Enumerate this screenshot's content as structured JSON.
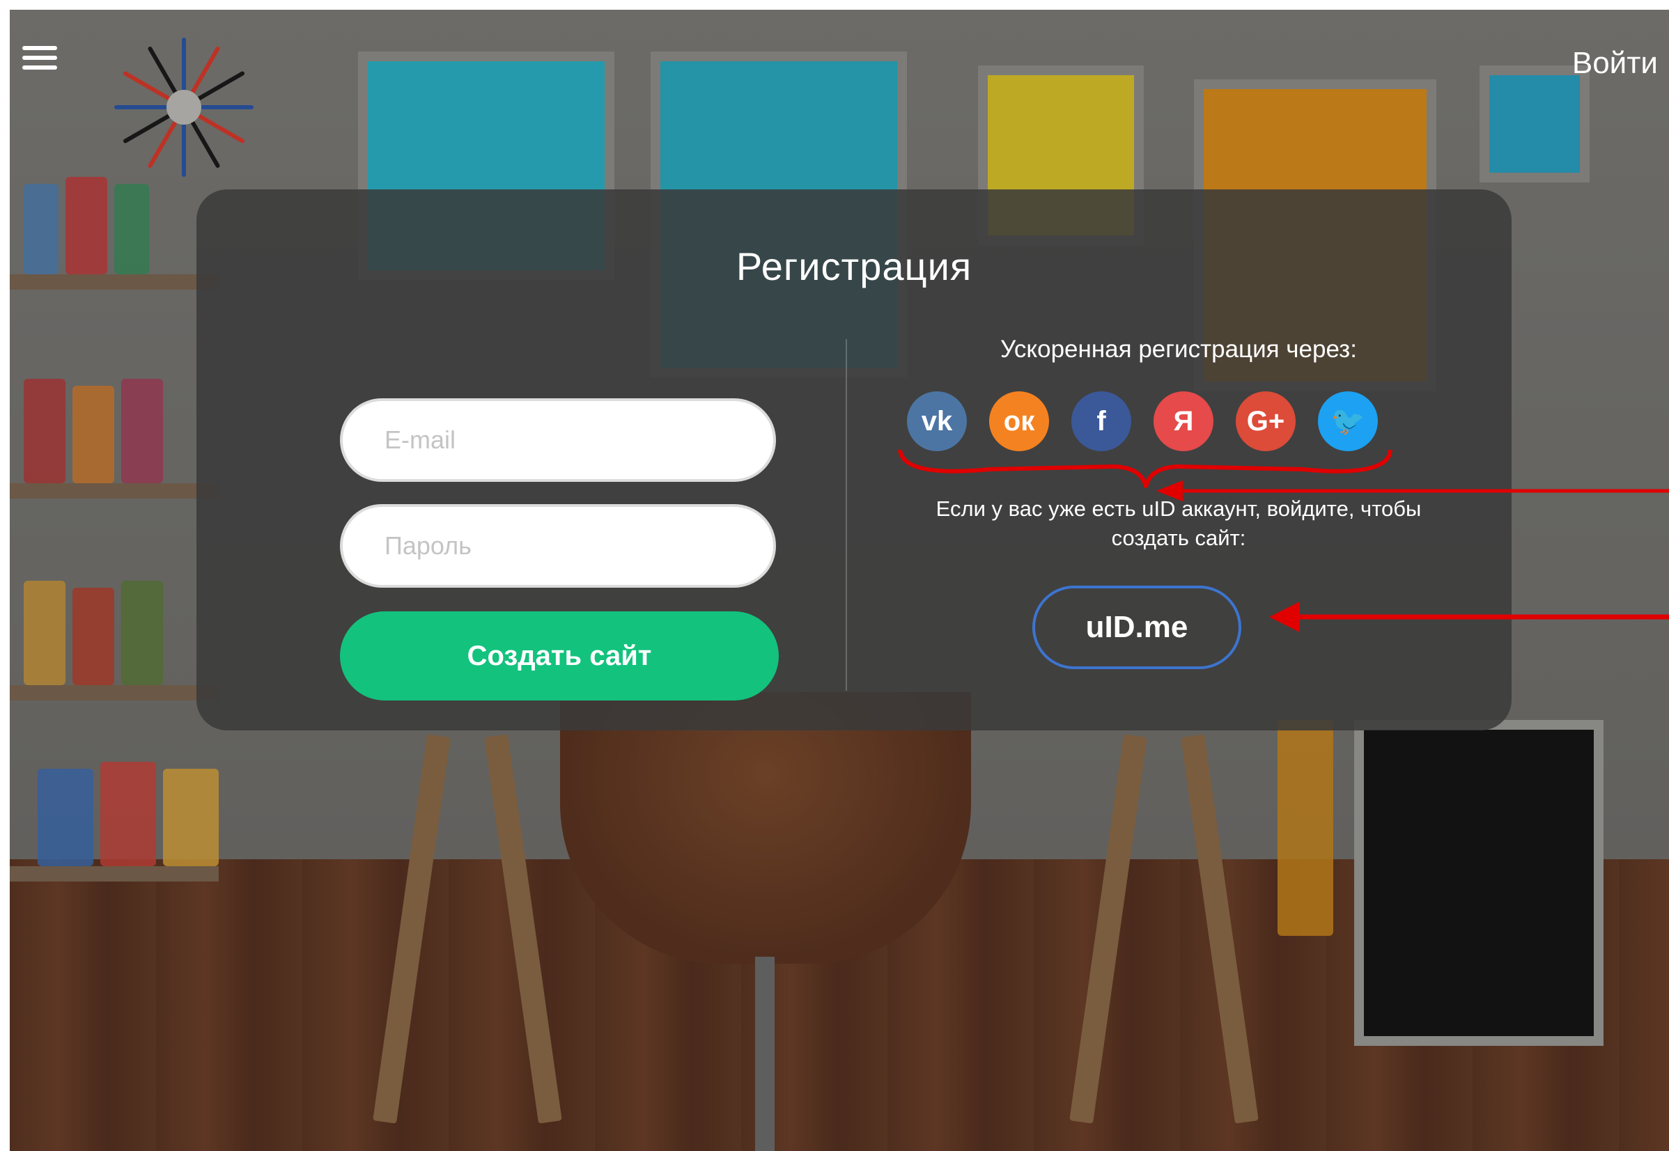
{
  "header": {
    "menu_icon": "hamburger-menu-icon",
    "login_label": "Войти"
  },
  "registration": {
    "title": "Регистрация",
    "email_placeholder": "E-mail",
    "password_placeholder": "Пароль",
    "create_button_label": "Создать сайт",
    "fast_registration_label": "Ускоренная регистрация через:",
    "social_networks": [
      {
        "name": "vk-icon",
        "glyph": "vk",
        "color": "#4c75a3"
      },
      {
        "name": "odnoklassniki-icon",
        "glyph": "ок",
        "color": "#f58220"
      },
      {
        "name": "facebook-icon",
        "glyph": "f",
        "color": "#3b5998"
      },
      {
        "name": "yandex-icon",
        "glyph": "Я",
        "color": "#e64a4a"
      },
      {
        "name": "google-plus-icon",
        "glyph": "G+",
        "color": "#dd4b39"
      },
      {
        "name": "twitter-icon",
        "glyph": "🐦",
        "color": "#1da1f2"
      }
    ],
    "uid_hint_line1": "Если у вас уже есть uID аккаунт, войдите, чтобы",
    "uid_hint_line2": "создать сайт:",
    "uid_button_label": "uID.me"
  },
  "colors": {
    "accent_green": "#13c27d",
    "uid_border_blue": "#3d74cf",
    "annotation_red": "#e00000"
  }
}
